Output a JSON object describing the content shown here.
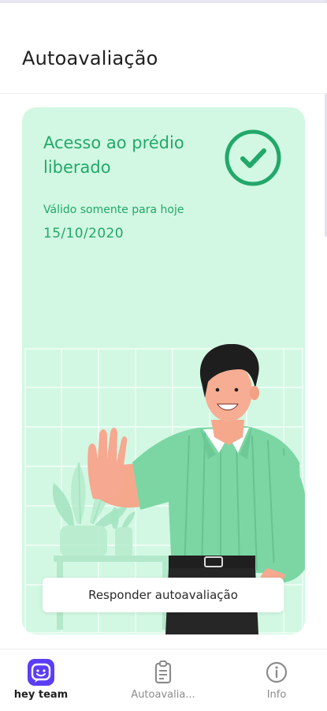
{
  "header": {
    "title": "Autoavaliação"
  },
  "status_card": {
    "title": "Acesso ao prédio liberado",
    "valid_label": "Válido somente para hoje",
    "valid_date": "15/10/2020",
    "check_icon": "check-circle-icon",
    "respond_button_label": "Responder autoavaliação"
  },
  "bottom_nav": {
    "items": [
      {
        "label": "hey team",
        "icon": "hey-team-logo-icon",
        "active": true
      },
      {
        "label": "Autoavalia...",
        "icon": "clipboard-icon",
        "active": false
      },
      {
        "label": "Info",
        "icon": "info-icon",
        "active": false
      }
    ]
  },
  "colors": {
    "accent_green": "#22a86a",
    "card_background": "#d2f8e3",
    "brand_purple": "#5b3df5",
    "shirt_green": "#7cd6a4"
  }
}
